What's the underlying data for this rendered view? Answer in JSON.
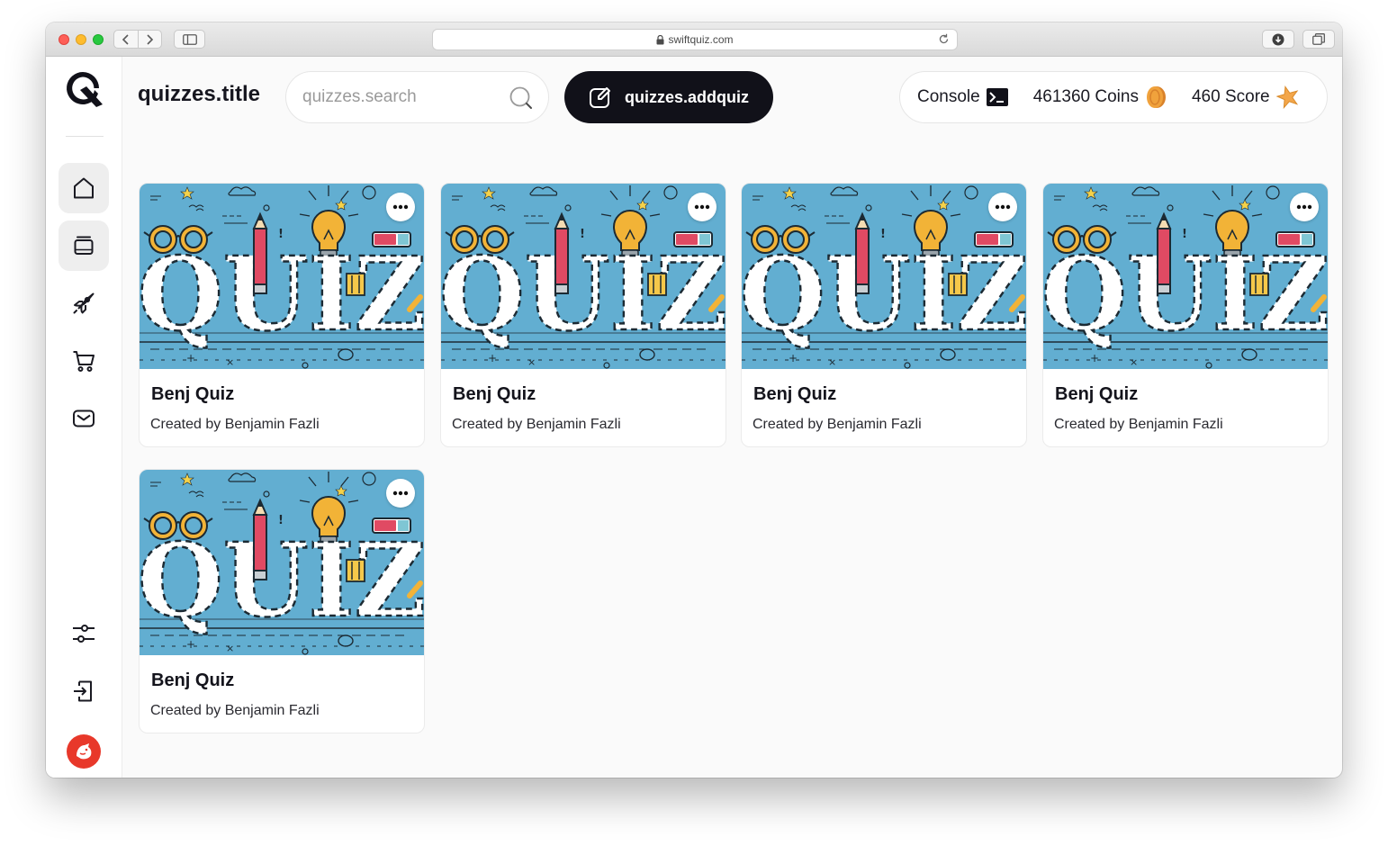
{
  "browser": {
    "url": "swiftquiz.com"
  },
  "header": {
    "title": "quizzes.title",
    "search_placeholder": "quizzes.search",
    "add_quiz_label": "quizzes.addquiz",
    "stats": {
      "console_label": "Console",
      "coins_label": "461360 Coins",
      "score_label": "460 Score"
    }
  },
  "sidebar": {
    "items": [
      {
        "name": "home",
        "icon": "home-icon",
        "active": true
      },
      {
        "name": "quizzes",
        "icon": "cards-icon",
        "active": true
      },
      {
        "name": "rocket",
        "icon": "rocket-icon",
        "active": false
      },
      {
        "name": "shop",
        "icon": "cart-icon",
        "active": false
      },
      {
        "name": "messages",
        "icon": "mail-icon",
        "active": false
      }
    ],
    "bottom_items": [
      {
        "name": "settings",
        "icon": "sliders-icon"
      },
      {
        "name": "logout",
        "icon": "sign-out-icon"
      }
    ]
  },
  "quizzes": [
    {
      "title": "Benj Quiz",
      "author": "Created by Benjamin Fazli",
      "cover_text": "QUIZ"
    },
    {
      "title": "Benj Quiz",
      "author": "Created by Benjamin Fazli",
      "cover_text": "QUIZ"
    },
    {
      "title": "Benj Quiz",
      "author": "Created by Benjamin Fazli",
      "cover_text": "QUIZ"
    },
    {
      "title": "Benj Quiz",
      "author": "Created by Benjamin Fazli",
      "cover_text": "QUIZ"
    },
    {
      "title": "Benj Quiz",
      "author": "Created by Benjamin Fazli",
      "cover_text": "QUIZ"
    }
  ],
  "colors": {
    "accent_dark": "#111119",
    "cover_blue": "#62aed1",
    "coin": "#f0a23c",
    "star": "#f3a64a",
    "avatar": "#e8382a"
  }
}
